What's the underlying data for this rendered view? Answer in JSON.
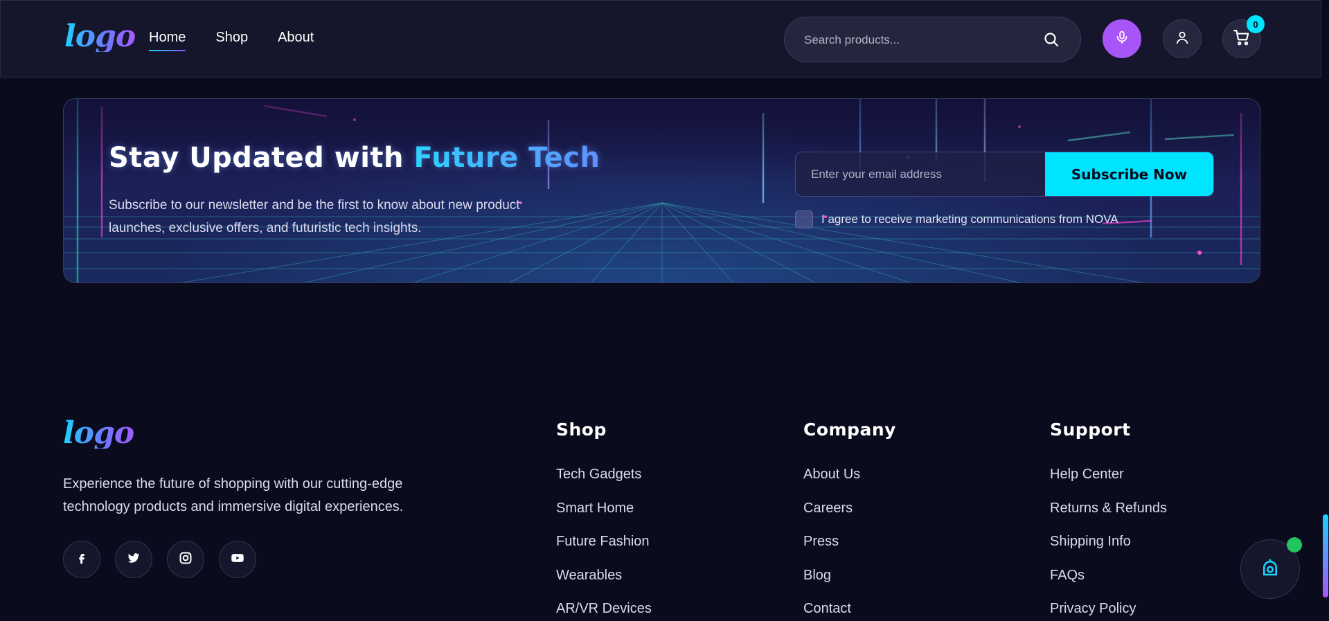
{
  "header": {
    "logo": "logo",
    "nav": [
      {
        "label": "Home",
        "active": true
      },
      {
        "label": "Shop",
        "active": false
      },
      {
        "label": "About",
        "active": false
      }
    ],
    "search_placeholder": "Search products...",
    "cart_count": "0"
  },
  "newsletter": {
    "title_main": "Stay Updated with ",
    "title_accent": "Future Tech",
    "description": "Subscribe to our newsletter and be the first to know about new product launches, exclusive offers, and futuristic tech insights.",
    "email_placeholder": "Enter your email address",
    "button_label": "Subscribe Now",
    "agree_text": "I agree to receive marketing communications from NOVA"
  },
  "footer": {
    "logo": "logo",
    "description": "Experience the future of shopping with our cutting-edge technology products and immersive digital experiences.",
    "social": [
      "facebook-icon",
      "twitter-icon",
      "instagram-icon",
      "youtube-icon"
    ],
    "columns": [
      {
        "title": "Shop",
        "links": [
          "Tech Gadgets",
          "Smart Home",
          "Future Fashion",
          "Wearables",
          "AR/VR Devices"
        ]
      },
      {
        "title": "Company",
        "links": [
          "About Us",
          "Careers",
          "Press",
          "Blog",
          "Contact"
        ]
      },
      {
        "title": "Support",
        "links": [
          "Help Center",
          "Returns & Refunds",
          "Shipping Info",
          "FAQs",
          "Privacy Policy"
        ]
      }
    ]
  },
  "colors": {
    "background": "#0b0b1e",
    "accent_cyan": "#00e5ff",
    "accent_purple": "#a855f7",
    "online_green": "#22c55e"
  }
}
